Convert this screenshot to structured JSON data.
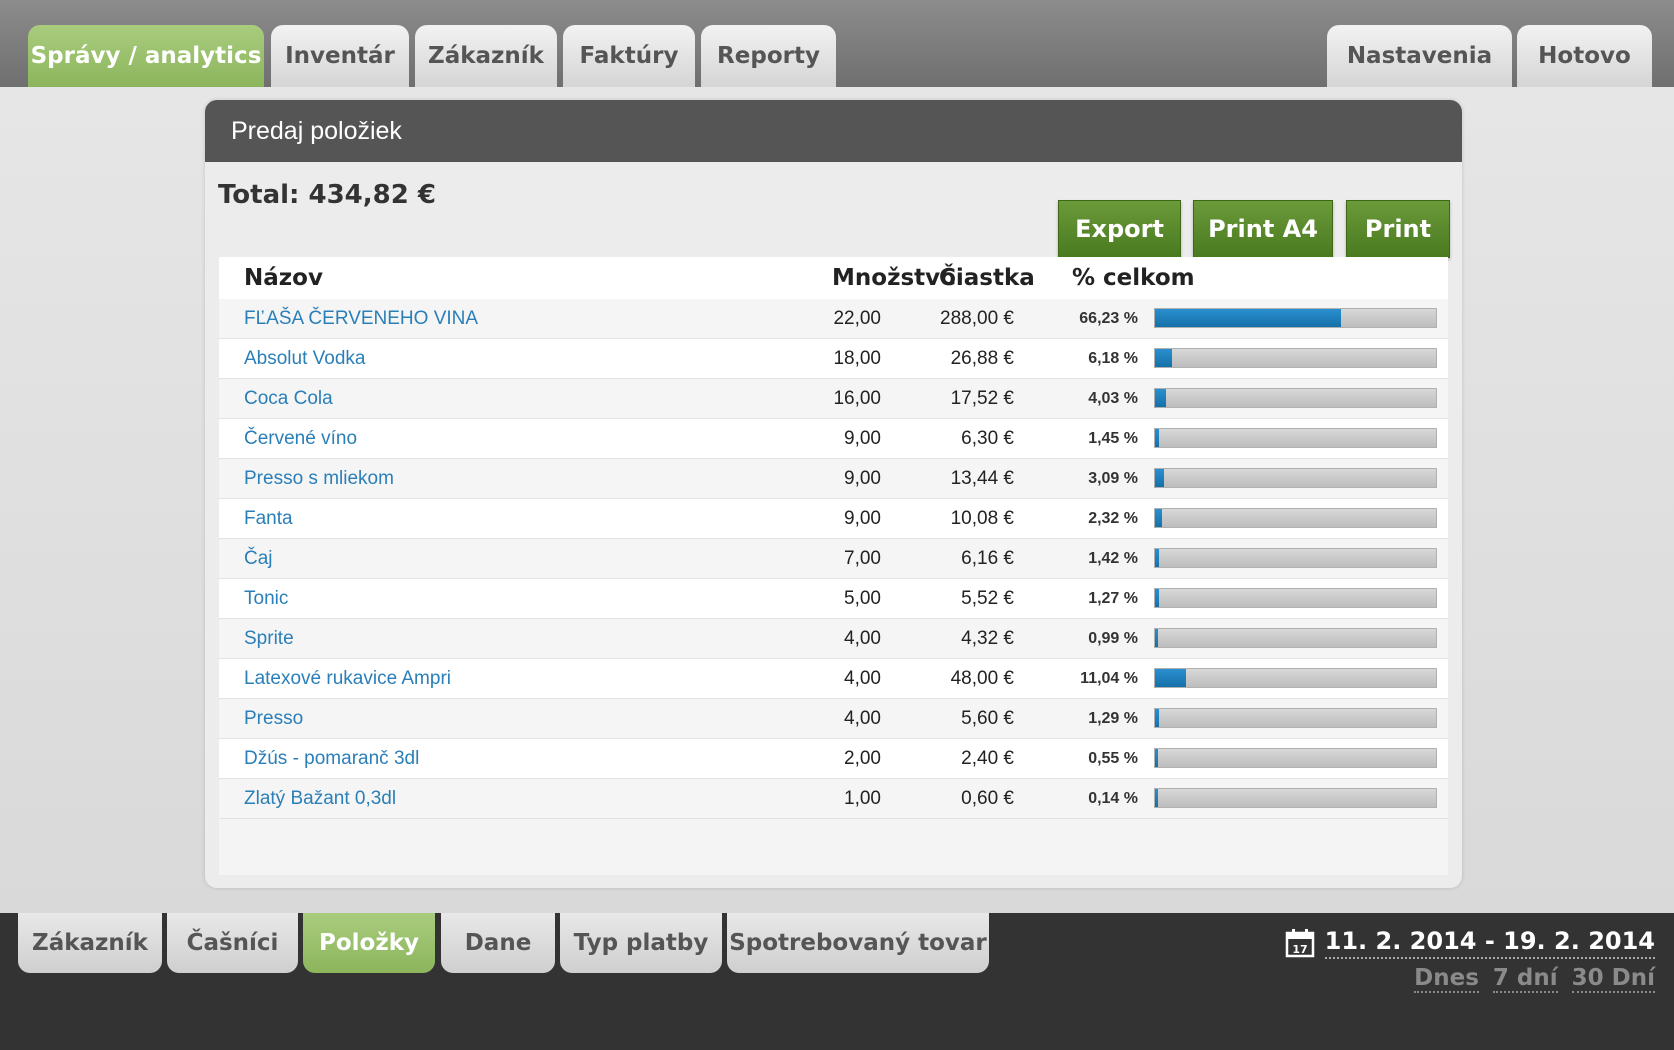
{
  "top_tabs": {
    "left": [
      {
        "label": "Správy / analytics",
        "active": true
      },
      {
        "label": "Inventár",
        "active": false
      },
      {
        "label": "Zákazník",
        "active": false
      },
      {
        "label": "Faktúry",
        "active": false
      },
      {
        "label": "Reporty",
        "active": false
      }
    ],
    "right": [
      {
        "label": "Nastavenia"
      },
      {
        "label": "Hotovo"
      }
    ]
  },
  "panel": {
    "title": "Predaj položiek",
    "total": "Total: 434,82 €",
    "buttons": {
      "export": "Export",
      "print_a4": "Print A4",
      "print": "Print"
    }
  },
  "table": {
    "headers": {
      "name": "Názov",
      "qty": "Množstvo",
      "amount": "Čiastka",
      "pct": "% celkom"
    },
    "rows": [
      {
        "name": "FĽAŠA ČERVENEHO VINA",
        "qty": "22,00",
        "amount": "288,00 €",
        "pct": "66,23 %",
        "share": 0.6623
      },
      {
        "name": "Absolut Vodka",
        "qty": "18,00",
        "amount": "26,88 €",
        "pct": "6,18 %",
        "share": 0.0618
      },
      {
        "name": "Coca Cola",
        "qty": "16,00",
        "amount": "17,52 €",
        "pct": "4,03 %",
        "share": 0.0403
      },
      {
        "name": "Červené víno",
        "qty": "9,00",
        "amount": "6,30 €",
        "pct": "1,45 %",
        "share": 0.0145
      },
      {
        "name": "Presso s mliekom",
        "qty": "9,00",
        "amount": "13,44 €",
        "pct": "3,09 %",
        "share": 0.0309
      },
      {
        "name": "Fanta",
        "qty": "9,00",
        "amount": "10,08 €",
        "pct": "2,32 %",
        "share": 0.0232
      },
      {
        "name": "Čaj",
        "qty": "7,00",
        "amount": "6,16 €",
        "pct": "1,42 %",
        "share": 0.0142
      },
      {
        "name": "Tonic",
        "qty": "5,00",
        "amount": "5,52 €",
        "pct": "1,27 %",
        "share": 0.0127
      },
      {
        "name": "Sprite",
        "qty": "4,00",
        "amount": "4,32 €",
        "pct": "0,99 %",
        "share": 0.0099
      },
      {
        "name": "Latexové rukavice Ampri",
        "qty": "4,00",
        "amount": "48,00 €",
        "pct": "11,04 %",
        "share": 0.1104
      },
      {
        "name": "Presso",
        "qty": "4,00",
        "amount": "5,60 €",
        "pct": "1,29 %",
        "share": 0.0129
      },
      {
        "name": "Džús - pomaranč 3dl",
        "qty": "2,00",
        "amount": "2,40 €",
        "pct": "0,55 %",
        "share": 0.0055
      },
      {
        "name": "Zlatý Bažant 0,3dl",
        "qty": "1,00",
        "amount": "0,60 €",
        "pct": "0,14 %",
        "share": 0.0014
      }
    ]
  },
  "bottom_tabs": [
    {
      "label": "Zákazník",
      "active": false
    },
    {
      "label": "Čašníci",
      "active": false
    },
    {
      "label": "Položky",
      "active": true
    },
    {
      "label": "Dane",
      "active": false
    },
    {
      "label": "Typ platby",
      "active": false
    },
    {
      "label": "Spotrebovaný tovar",
      "active": false
    }
  ],
  "date": {
    "range": "11. 2. 2014 - 19. 2. 2014",
    "calendar_day": "17",
    "quick": [
      "Dnes",
      "7 dní",
      "30 Dní"
    ]
  },
  "colors": {
    "accent_green": "#8cb55c",
    "button_green": "#497a1f",
    "link_blue": "#2a7fb8",
    "bar_blue": "#1670a8",
    "header_dark": "#555555",
    "bottom_dark": "#333333"
  }
}
